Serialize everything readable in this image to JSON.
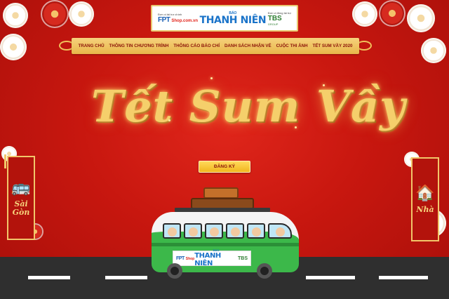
{
  "sponsors": {
    "left_caption": "Đơn vị tài trợ chính",
    "left_brand": "FPT",
    "left_sub": "Shop.com.vn",
    "center_small": "BÁO",
    "center_brand": "THANH NIÊN",
    "right_caption": "Đơn vị đồng tài trợ",
    "right_brand": "TBS",
    "right_sub": "GROUP"
  },
  "nav": {
    "items": [
      "TRANG CHỦ",
      "THÔNG TIN CHƯƠNG TRÌNH",
      "THÔNG CÁO BÁO CHÍ",
      "DANH SÁCH NHẬN VÉ",
      "CUỘC THI ẢNH",
      "TẾT SUM VẦY 2020"
    ]
  },
  "hero": {
    "title": "Tết Sum Vầy",
    "register_label": "ĐĂNG KÝ"
  },
  "side": {
    "left_label_1": "Sài",
    "left_label_2": "Gòn",
    "left_icon": "bus-icon",
    "right_label": "Nhà",
    "right_icon": "house-icon"
  },
  "bus_ad": {
    "left_brand": "FPT",
    "left_sub": "Shop",
    "center_small": "BÁO",
    "center_brand": "THANH NIÊN",
    "right_brand": "TBS"
  },
  "colors": {
    "background": "#c8170f",
    "gold": "#f5cf6b",
    "bus_green": "#3cb84a"
  }
}
